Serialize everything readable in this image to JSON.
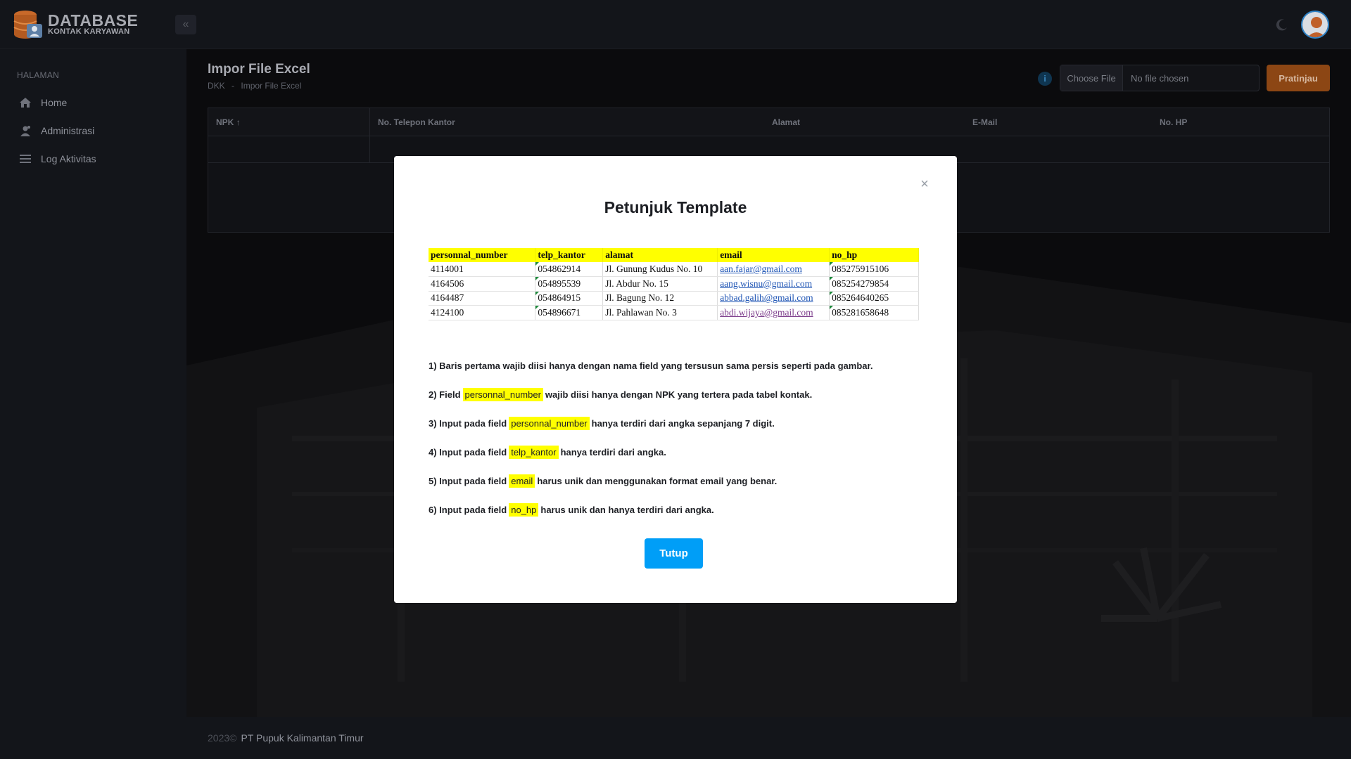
{
  "brand": {
    "title": "DATABASE",
    "subtitle": "KONTAK KARYAWAN"
  },
  "sidebar": {
    "heading": "HALAMAN",
    "items": [
      {
        "label": "Home",
        "icon": "home-icon"
      },
      {
        "label": "Administrasi",
        "icon": "user-settings-icon"
      },
      {
        "label": "Log Aktivitas",
        "icon": "list-icon"
      }
    ]
  },
  "header": {
    "title": "Impor File Excel",
    "breadcrumb": [
      "DKK",
      "-",
      "Impor File Excel"
    ],
    "file_button": "Choose File",
    "file_status": "No file chosen",
    "preview_button": "Pratinjau"
  },
  "table": {
    "columns": [
      "NPK",
      "No. Telepon Kantor",
      "Alamat",
      "E-Mail",
      "No. HP"
    ],
    "sort_indicator": "↑"
  },
  "modal": {
    "title": "Petunjuk Template",
    "close_symbol": "×",
    "template": {
      "headers": [
        "personnal_number",
        "telp_kantor",
        "alamat",
        "email",
        "no_hp"
      ],
      "rows": [
        [
          "4114001",
          "054862914",
          "Jl. Gunung Kudus No. 10",
          "aan.fajar@gmail.com",
          "085275915106"
        ],
        [
          "4164506",
          "054895539",
          "Jl. Abdur No. 15",
          "aang.wisnu@gmail.com",
          "085254279854"
        ],
        [
          "4164487",
          "054864915",
          "Jl. Bagung No. 12",
          "abbad.galih@gmail.com",
          "085264640265"
        ],
        [
          "4124100",
          "054896671",
          "Jl. Pahlawan No. 3",
          "abdi.wijaya@gmail.com",
          "085281658648"
        ]
      ]
    },
    "rules": [
      {
        "pre": "1) Baris pertama wajib diisi hanya dengan nama field yang tersusun sama persis seperti pada gambar.",
        "field": "",
        "post": ""
      },
      {
        "pre": "2) Field",
        "field": "personnal_number",
        "post": "wajib diisi hanya dengan NPK yang tertera pada tabel kontak."
      },
      {
        "pre": "3) Input pada field",
        "field": "personnal_number",
        "post": "hanya terdiri dari angka sepanjang 7 digit."
      },
      {
        "pre": "4) Input pada field",
        "field": "telp_kantor",
        "post": "hanya terdiri dari angka."
      },
      {
        "pre": "5) Input pada field",
        "field": "email",
        "post": "harus unik dan menggunakan format email yang benar."
      },
      {
        "pre": "6) Input pada field",
        "field": "no_hp",
        "post": "harus unik dan hanya terdiri dari angka."
      }
    ],
    "close_button": "Tutup"
  },
  "footer": {
    "year": "2023©",
    "company": "PT Pupuk Kalimantan Timur"
  },
  "colors": {
    "accent": "#009ef7",
    "preview": "#8c4614",
    "highlight": "#ffff00"
  }
}
